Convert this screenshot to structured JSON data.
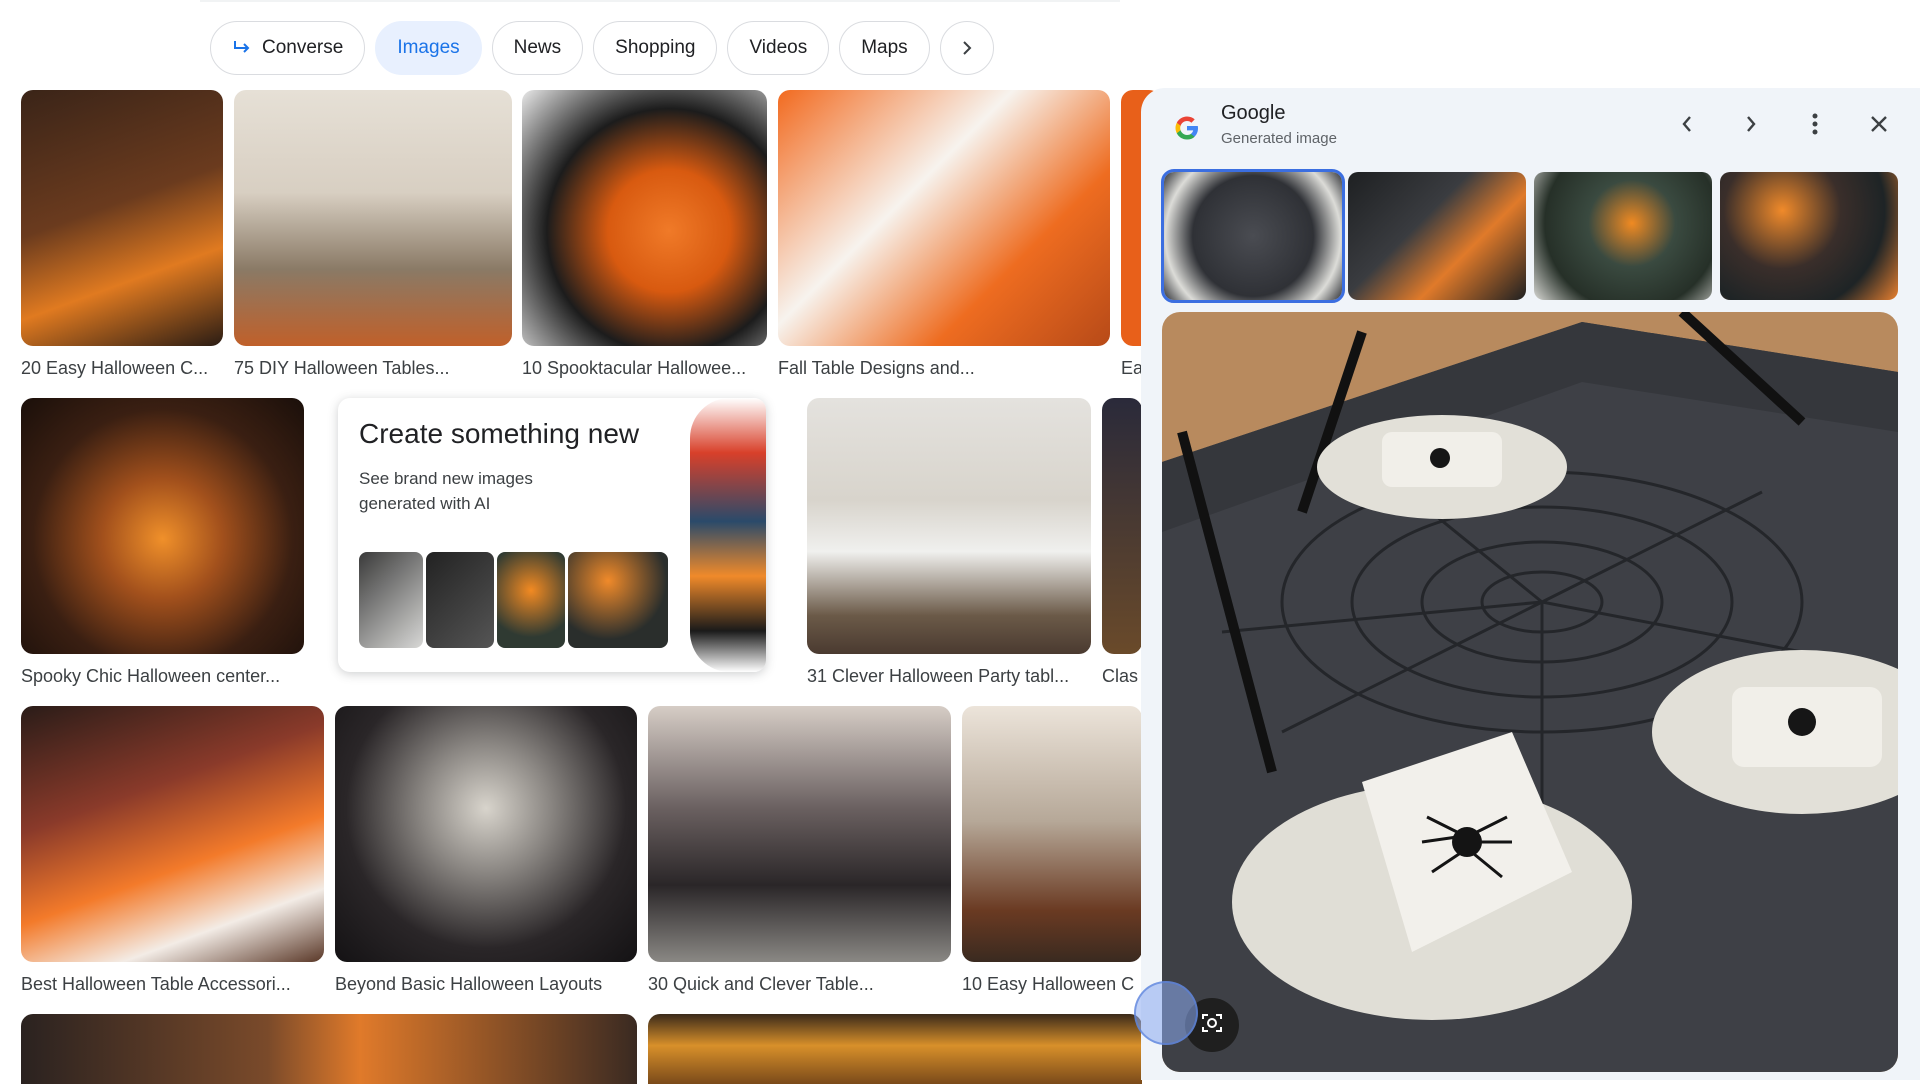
{
  "tabs": [
    {
      "label": "Converse",
      "icon": "converse-arrow-icon"
    },
    {
      "label": "Images",
      "active": true
    },
    {
      "label": "News"
    },
    {
      "label": "Shopping"
    },
    {
      "label": "Videos"
    },
    {
      "label": "Maps"
    }
  ],
  "results": {
    "row1": [
      "20 Easy Halloween C...",
      "75 DIY Halloween Tables...",
      "10 Spooktacular Hallowee...",
      "Fall Table Designs and...",
      "Ea"
    ],
    "row2": [
      "Spooky Chic Halloween center...",
      "31 Clever Halloween Party tabl...",
      "Clas"
    ],
    "row3": [
      "Best Halloween Table Accessori...",
      "Beyond Basic Halloween Layouts",
      "30 Quick and Clever Table...",
      "10 Easy Halloween C"
    ]
  },
  "create_card": {
    "title": "Create something new",
    "subtitle": "See brand new images generated with AI"
  },
  "panel": {
    "title": "Google",
    "subtitle": "Generated image"
  },
  "colors": {
    "accent": "#1a73e8",
    "panel_bg": "#f0f4f9",
    "selected_outline": "#3b6ee0"
  }
}
